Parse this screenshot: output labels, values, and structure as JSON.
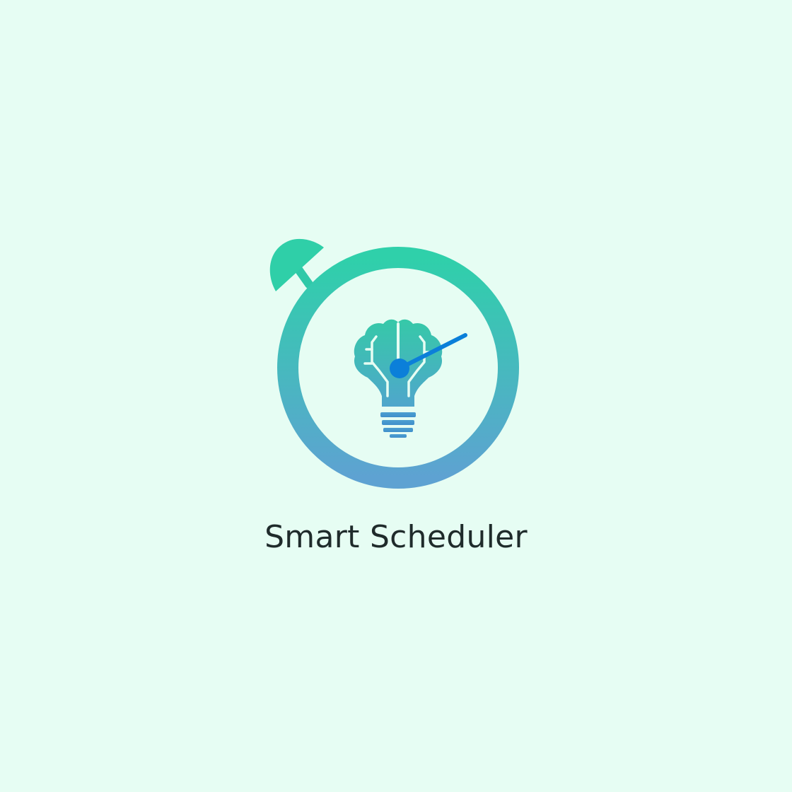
{
  "app": {
    "name": "Smart Scheduler"
  },
  "icons": {
    "logo": "stopwatch-brain-lightbulb-icon",
    "crown": "stopwatch-crown-icon",
    "bulb": "brain-lightbulb-icon",
    "hand": "clock-hand-icon"
  },
  "colors": {
    "background": "#e6fdf3",
    "gradient_top": "#2fd0aa",
    "gradient_bottom": "#5ea2d2",
    "clock_hand": "#0b7fd9",
    "text": "#1f2b2b"
  }
}
